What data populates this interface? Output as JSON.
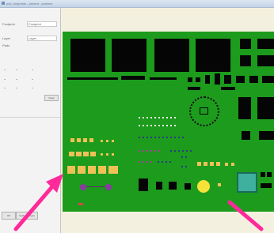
{
  "window": {
    "title": "pcb_footprints - printed - pcbnew"
  },
  "left_panel": {
    "labels": [
      {
        "key": "Footprint",
        "value": "Footprint"
      },
      {
        "key": "Layer",
        "value": "Layer"
      },
      {
        "key": "Pads",
        "value": "Pads"
      }
    ],
    "button_label": "Clear",
    "footer_button": "OK",
    "footer_button2": "Apply changes"
  },
  "canvas": {
    "board_color": "#1d9b1d",
    "background_color": "#f4f0df",
    "pad_color": "#efc157",
    "component_color": "#050505"
  },
  "annotations": {
    "arrow_color": "#ff2a9a",
    "arrows": [
      "arrow-left",
      "arrow-right"
    ]
  }
}
